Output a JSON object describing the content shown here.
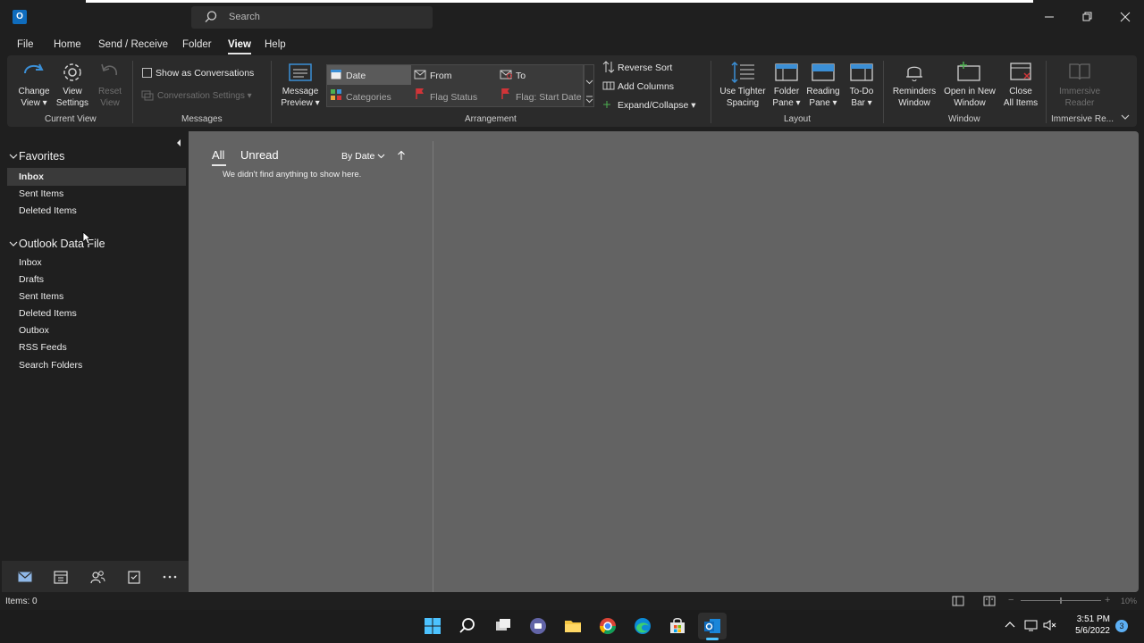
{
  "titlebar": {
    "app_icon_text": "O",
    "search_placeholder": "Search"
  },
  "menu": {
    "file": "File",
    "home": "Home",
    "send_receive": "Send / Receive",
    "folder": "Folder",
    "view": "View",
    "help": "Help"
  },
  "ribbon": {
    "change_view": [
      "Change",
      "View ▾"
    ],
    "view_settings": [
      "View",
      "Settings"
    ],
    "reset_view": [
      "Reset",
      "View"
    ],
    "current_view_group": "Current View",
    "show_as_conversations": "Show as Conversations",
    "conversation_settings": "Conversation Settings ▾",
    "messages_group": "Messages",
    "message_preview": [
      "Message",
      "Preview ▾"
    ],
    "arrangement": {
      "date": "Date",
      "from": "From",
      "to": "To",
      "categories": "Categories",
      "flag_status": "Flag Status",
      "flag_start_date": "Flag: Start Date"
    },
    "reverse_sort": "Reverse Sort",
    "add_columns": "Add Columns",
    "expand_collapse": "Expand/Collapse ▾",
    "arrangement_group": "Arrangement",
    "use_tighter_spacing": [
      "Use Tighter",
      "Spacing"
    ],
    "folder_pane": [
      "Folder",
      "Pane ▾"
    ],
    "reading_pane": [
      "Reading",
      "Pane ▾"
    ],
    "todo_bar": [
      "To-Do",
      "Bar ▾"
    ],
    "layout_group": "Layout",
    "reminders_window": [
      "Reminders",
      "Window"
    ],
    "open_in_new_window": [
      "Open in New",
      "Window"
    ],
    "close_all_items": [
      "Close",
      "All Items"
    ],
    "window_group": "Window",
    "immersive_reader": [
      "Immersive",
      "Reader"
    ],
    "immersive_group": "Immersive Re..."
  },
  "nav": {
    "favorites": "Favorites",
    "favorites_items": [
      "Inbox",
      "Sent Items",
      "Deleted Items"
    ],
    "data_file": "Outlook Data File",
    "data_file_items": [
      "Inbox",
      "Drafts",
      "Sent Items",
      "Deleted Items",
      "Outbox",
      "RSS Feeds",
      "Search Folders"
    ]
  },
  "list": {
    "tab_all": "All",
    "tab_unread": "Unread",
    "sort_by": "By Date",
    "empty_message": "We didn't find anything to show here."
  },
  "status": {
    "items": "Items: 0",
    "zoom": "10%"
  },
  "taskbar": {
    "time": "3:51 PM",
    "date": "5/6/2022",
    "notifications": "3"
  },
  "colors": {
    "accent": "#0f6cbd",
    "outlook_blue": "#1a86d9",
    "flag_red": "#d13438"
  }
}
